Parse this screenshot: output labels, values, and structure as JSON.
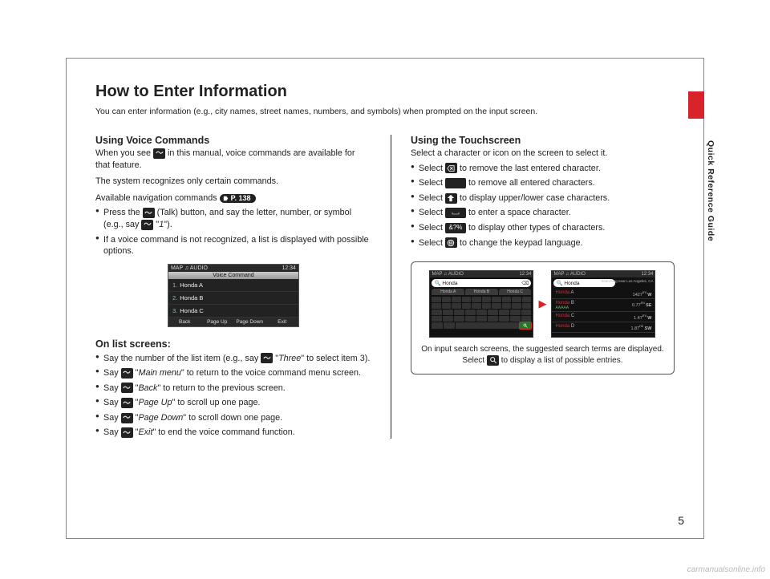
{
  "sideLabel": "Quick Reference Guide",
  "title": "How to Enter Information",
  "subtitle": "You can enter information (e.g., city names, street names, numbers, and symbols) when prompted on the input screen.",
  "pageNumber": "5",
  "watermark": "carmanualsonline.info",
  "left": {
    "h1": "Using Voice Commands",
    "p1a": "When you see ",
    "p1b": " in this manual, voice commands are available for that feature.",
    "p2": "The system recognizes only certain commands.",
    "p3": "Available navigation commands ",
    "pageRef": "P. 138",
    "bullets": [
      {
        "a": "Press the ",
        "b": " (Talk) button, and say the letter, number, or symbol (e.g., say ",
        "c": " \"",
        "cmd": "1",
        "d": "\")."
      },
      {
        "text": "If a voice command is not recognized, a list is displayed with possible options."
      }
    ],
    "shot": {
      "topLeft": "MAP  ♫ AUDIO",
      "topRight": "12:34",
      "header": "Voice Command",
      "rows": [
        {
          "n": "1.",
          "t": "Honda A"
        },
        {
          "n": "2.",
          "t": "Honda B"
        },
        {
          "n": "3.",
          "t": "Honda C"
        }
      ],
      "foot": [
        "Back",
        "Page Up",
        "Page Down",
        "Exit"
      ]
    },
    "h2": "On list screens:",
    "list2": [
      {
        "a": "Say the number of the list item (e.g., say ",
        "cmd": "Three",
        "b": "\" to select item 3)."
      },
      {
        "a": "Say ",
        "cmd": "Main menu",
        "b": "\" to return to the voice command menu screen."
      },
      {
        "a": "Say ",
        "cmd": "Back",
        "b": "\" to return to the previous screen."
      },
      {
        "a": "Say ",
        "cmd": "Page Up",
        "b": "\" to scroll up one page."
      },
      {
        "a": "Say ",
        "cmd": "Page Down",
        "b": "\" to scroll down one page."
      },
      {
        "a": "Say ",
        "cmd": "Exit",
        "b": "\" to end the voice command function."
      }
    ]
  },
  "right": {
    "h1": "Using the Touchscreen",
    "p1": "Select a character or icon on the screen to select it.",
    "bullets": [
      "to remove the last entered character.",
      "to remove all entered characters.",
      "to display upper/lower case characters.",
      "to enter a space character.",
      "to display other types of characters.",
      "to change the keypad language."
    ],
    "selectWord": "Select ",
    "iconLabels": [
      "delete-char-icon",
      "clear-all-icon",
      "shift-icon",
      "space-icon",
      "symbols-icon",
      "globe-icon"
    ],
    "symbolsText": "&?%",
    "shot": {
      "topLeft": "MAP  ♫ AUDIO",
      "topRight": "12:34",
      "search": "Honda",
      "tabs": [
        "Honda A",
        "Honda B",
        "Honda C"
      ],
      "results": [
        {
          "t": "Honda A",
          "d": "1427",
          "dir": "W"
        },
        {
          "t": "Honda B",
          "s": "AAAAA",
          "d": "0.77",
          "dir": "SE"
        },
        {
          "t": "Honda C",
          "d": "1.47",
          "dir": "W"
        },
        {
          "t": "Honda D",
          "d": "1.87",
          "dir": "SW"
        }
      ],
      "sideCap": "Searching near Los Angeles, CA"
    },
    "caption_a": "On input search screens, the suggested search terms are displayed. Select ",
    "caption_b": " to display a list of possible entries."
  }
}
